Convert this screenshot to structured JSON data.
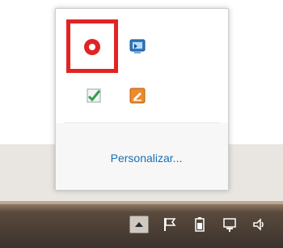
{
  "tray_popup": {
    "customize_link": "Personalizar..."
  },
  "icons": {
    "recording": "record-icon",
    "remote_desktop": "remote-desktop-icon",
    "checklist": "checkbox-icon",
    "sign_tool": "signature-icon"
  },
  "taskbar": {
    "tray_icons": [
      "show-hidden-icons-button",
      "action-center-flag-icon",
      "battery-icon",
      "network-icon",
      "volume-icon"
    ]
  },
  "colors": {
    "selection_red": "#e02424",
    "link_blue": "#1b6fb3"
  }
}
